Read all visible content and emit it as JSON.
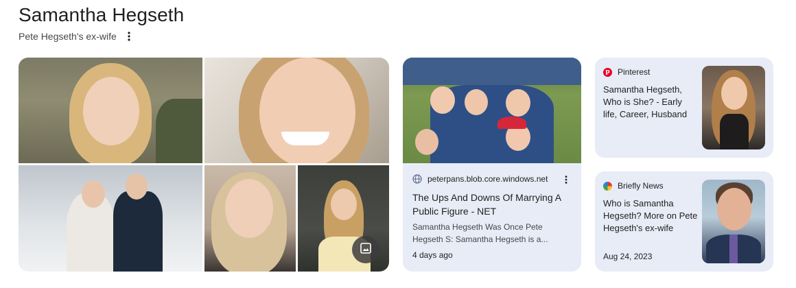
{
  "header": {
    "title": "Samantha Hegseth",
    "subtitle": "Pete Hegseth's ex-wife"
  },
  "icons": {
    "more": "more-vert-icon",
    "gallery": "image-gallery-icon",
    "globe": "globe-icon",
    "pinterest": "pinterest-logo-icon",
    "briefly": "briefly-news-logo-icon"
  },
  "middle_card": {
    "source": "peterpans.blob.core.windows.net",
    "title": "The Ups And Downs Of Marrying A Public Figure - NET",
    "snippet": "Samantha Hegseth Was Once Pete Hegseth S: Samantha Hegseth is a...",
    "date": "4 days ago"
  },
  "right_cards": [
    {
      "source": "Pinterest",
      "title": "Samantha Hegseth, Who is She? - Early life, Career, Husband",
      "date": ""
    },
    {
      "source": "Briefly News",
      "title": "Who is Samantha Hegseth? More on Pete Hegseth's ex-wife",
      "date": "Aug 24, 2023"
    }
  ],
  "colors": {
    "card_bg": "#e8ecf7",
    "title_text": "#1f1f1f",
    "secondary_text": "#474747"
  }
}
